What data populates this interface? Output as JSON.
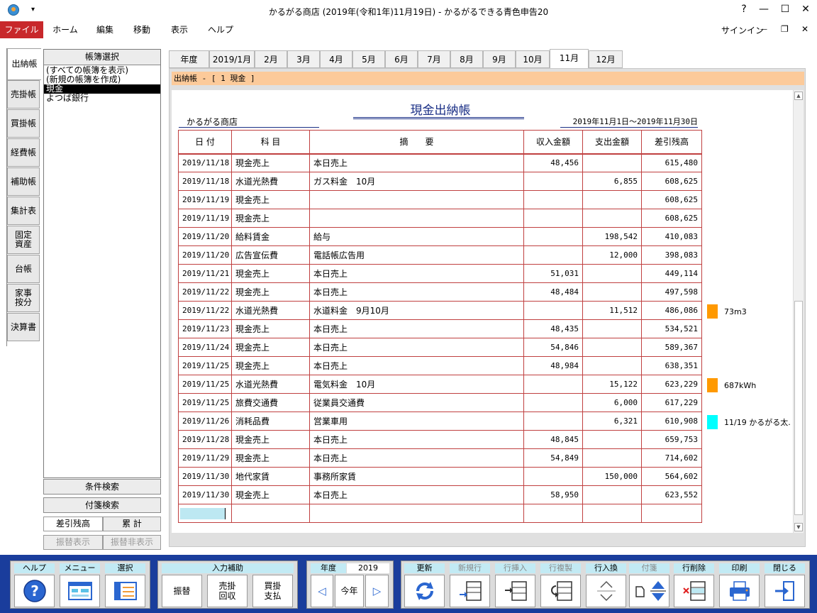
{
  "window": {
    "title": "かるがる商店 (2019年(令和1年)11月19日) - かるがるできる青色申告20",
    "help": "?",
    "minimize": "—",
    "maximize": "☐",
    "close": "✕"
  },
  "ribbon": {
    "tabs": [
      "ファイル",
      "ホーム",
      "編集",
      "移動",
      "表示",
      "ヘルプ"
    ],
    "signin": "サインイン",
    "min": "—",
    "restore": "❐",
    "close": "✕"
  },
  "sidebar": {
    "tabs": [
      "出納帳",
      "売掛帳",
      "買掛帳",
      "経費帳",
      "補助帳",
      "集計表",
      "固定\n資産",
      "台帳",
      "家事\n按分",
      "決算書"
    ]
  },
  "ledger_panel": {
    "header": "帳簿選択",
    "items": [
      "(すべての帳簿を表示)",
      "(新規の帳簿を作成)",
      "現金",
      "よつば銀行"
    ]
  },
  "left_buttons": {
    "condition_search": "条件検索",
    "tag_search": "付箋検索",
    "balance": "差引残高",
    "cumulative": "累 計",
    "transfer_show": "振替表示",
    "transfer_hide": "振替非表示"
  },
  "month_tabs": [
    "年度",
    "2019/1月",
    "2月",
    "3月",
    "4月",
    "5月",
    "6月",
    "7月",
    "8月",
    "9月",
    "10月",
    "11月",
    "12月"
  ],
  "breadcrumb": "出納帳 - [ 1 現金 ]",
  "book": {
    "title": "現金出納帳",
    "shop": "かるがる商店",
    "period": "2019年11月1日～2019年11月30日"
  },
  "table": {
    "headers": [
      "日 付",
      "科 目",
      "摘　　要",
      "収入金額",
      "支出金額",
      "差引残高"
    ],
    "rows": [
      [
        "2019/11/18",
        "現金売上",
        "本日売上",
        "48,456",
        "",
        "615,480"
      ],
      [
        "2019/11/18",
        "水道光熱費",
        "ガス料金　10月",
        "",
        "6,855",
        "608,625"
      ],
      [
        "2019/11/19",
        "現金売上",
        "",
        "",
        "",
        "608,625"
      ],
      [
        "2019/11/19",
        "現金売上",
        "",
        "",
        "",
        "608,625"
      ],
      [
        "2019/11/20",
        "給料賃金",
        "給与",
        "",
        "198,542",
        "410,083"
      ],
      [
        "2019/11/20",
        "広告宣伝費",
        "電話帳広告用",
        "",
        "12,000",
        "398,083"
      ],
      [
        "2019/11/21",
        "現金売上",
        "本日売上",
        "51,031",
        "",
        "449,114"
      ],
      [
        "2019/11/22",
        "現金売上",
        "本日売上",
        "48,484",
        "",
        "497,598"
      ],
      [
        "2019/11/22",
        "水道光熱費",
        "水道料金　9月10月",
        "",
        "11,512",
        "486,086"
      ],
      [
        "2019/11/23",
        "現金売上",
        "本日売上",
        "48,435",
        "",
        "534,521"
      ],
      [
        "2019/11/24",
        "現金売上",
        "本日売上",
        "54,846",
        "",
        "589,367"
      ],
      [
        "2019/11/25",
        "現金売上",
        "本日売上",
        "48,984",
        "",
        "638,351"
      ],
      [
        "2019/11/25",
        "水道光熱費",
        "電気料金　10月",
        "",
        "15,122",
        "623,229"
      ],
      [
        "2019/11/25",
        "旅費交通費",
        "従業員交通費",
        "",
        "6,000",
        "617,229"
      ],
      [
        "2019/11/26",
        "消耗品費",
        "営業車用",
        "",
        "6,321",
        "610,908"
      ],
      [
        "2019/11/28",
        "現金売上",
        "本日売上",
        "48,845",
        "",
        "659,753"
      ],
      [
        "2019/11/29",
        "現金売上",
        "本日売上",
        "54,849",
        "",
        "714,602"
      ],
      [
        "2019/11/30",
        "地代家賃",
        "事務所家賃",
        "",
        "150,000",
        "564,602"
      ],
      [
        "2019/11/30",
        "現金売上",
        "本日売上",
        "58,950",
        "",
        "623,552"
      ]
    ]
  },
  "notes": [
    {
      "text": "73m3",
      "color": "#ff9900"
    },
    {
      "text": "687kWh",
      "color": "#ff9900"
    },
    {
      "text": "11/19 かるがる太.",
      "color": "#00ffff"
    }
  ],
  "toolbar": {
    "help": "ヘルプ",
    "menu": "メニュー",
    "select": "選択",
    "input_assist": "入力補助",
    "transfer": "振替",
    "receivable": "売掛\n回収",
    "payable": "買掛\n支払",
    "fiscal_year": "年度",
    "year_value": "2019",
    "prev": "◁",
    "this_year": "今年",
    "next": "▷",
    "update": "更新",
    "new_row": "新規行",
    "insert_row": "行挿入",
    "copy_row": "行複製",
    "swap_row": "行入換",
    "tag": "付箋",
    "delete_row": "行削除",
    "print": "印刷",
    "close": "閉じる"
  }
}
